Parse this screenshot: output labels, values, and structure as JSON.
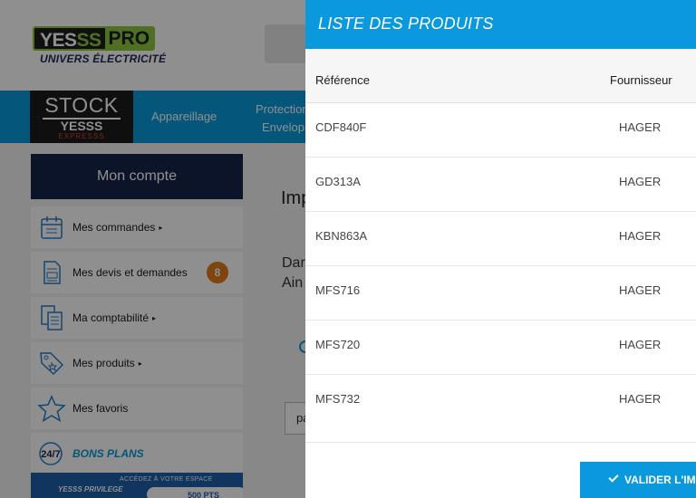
{
  "header": {
    "logo_part1": "YES",
    "logo_part1_green": "SS",
    "logo_part2": "PRO",
    "logo_tagline": "UNIVERS ÉLECTRICITÉ"
  },
  "stock_badge": {
    "title": "STOCK",
    "brand": "YESSS",
    "sub": "EXPRESSS"
  },
  "nav": {
    "items": [
      {
        "label": "Appareillage"
      },
      {
        "label": "Protection",
        "label2": "Envelop"
      }
    ]
  },
  "sidebar": {
    "account_title": "Mon compte",
    "items": [
      {
        "label": "Mes commandes",
        "caret": "▸",
        "icon": "calendar-icon"
      },
      {
        "label": "Mes devis et demandes",
        "badge": "8",
        "icon": "quote-document-icon"
      },
      {
        "label": "Ma comptabilité",
        "caret": "▸",
        "icon": "accounting-icon"
      },
      {
        "label": "Mes produits",
        "caret": "▸",
        "icon": "product-tag-icon"
      },
      {
        "label": "Mes favoris",
        "icon": "star-icon"
      },
      {
        "label": "BONS PLANS",
        "icon": "24-7-icon"
      }
    ],
    "promo": {
      "brand": "YESSS PRIVILEGE",
      "text": "ACCÉDEZ À VOTRE ESPACE",
      "points": "500 PTS"
    }
  },
  "main": {
    "title_partial": "Imp",
    "line1_partial": "Dar",
    "line2_partial": "Ain",
    "select_partial": "pa"
  },
  "modal": {
    "title": "LISTE DES PRODUITS",
    "columns": [
      "Référence",
      "Fournisseur"
    ],
    "rows": [
      {
        "ref": "CDF840F",
        "supplier": "HAGER"
      },
      {
        "ref": "GD313A",
        "supplier": "HAGER"
      },
      {
        "ref": "KBN863A",
        "supplier": "HAGER"
      },
      {
        "ref": "MFS716",
        "supplier": "HAGER"
      },
      {
        "ref": "MFS720",
        "supplier": "HAGER"
      },
      {
        "ref": "MFS732",
        "supplier": "HAGER"
      }
    ],
    "validate_label": "VALIDER L'IMP"
  },
  "colors": {
    "primary": "#0a99dc",
    "navy": "#162549",
    "badge": "#e07c1a",
    "logo_green": "#8dc63f"
  }
}
